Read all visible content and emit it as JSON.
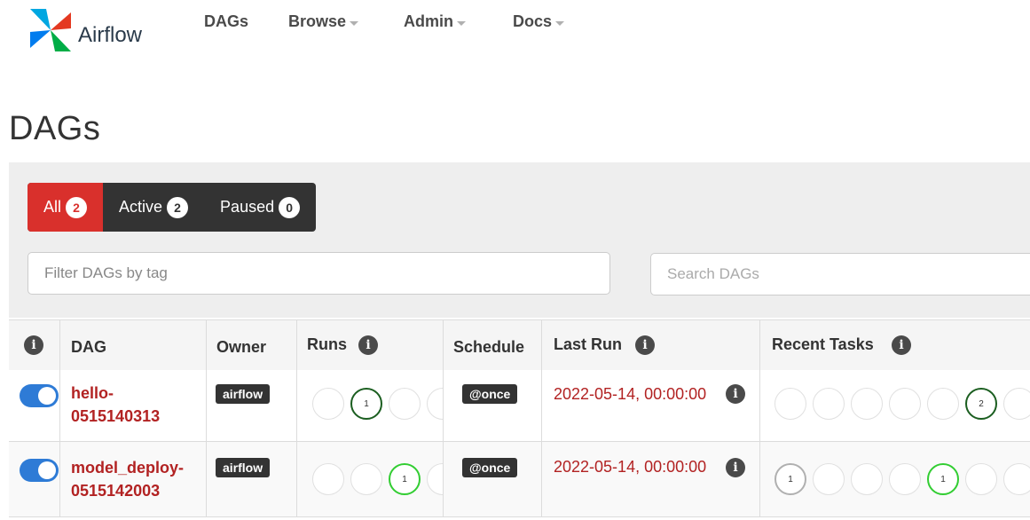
{
  "app": {
    "brand": "Airflow",
    "nav": {
      "dags": "DAGs",
      "browse": "Browse",
      "admin": "Admin",
      "docs": "Docs"
    }
  },
  "page": {
    "title": "DAGs"
  },
  "filters": {
    "all": {
      "label": "All",
      "count": "2"
    },
    "active": {
      "label": "Active",
      "count": "2"
    },
    "paused": {
      "label": "Paused",
      "count": "0"
    }
  },
  "tag_filter": {
    "placeholder": "Filter DAGs by tag"
  },
  "search": {
    "placeholder": "Search DAGs"
  },
  "table": {
    "headers": {
      "info": "i",
      "dag": "DAG",
      "owner": "Owner",
      "runs": "Runs",
      "schedule": "Schedule",
      "last_run": "Last Run",
      "recent_tasks": "Recent Tasks"
    },
    "rows": [
      {
        "dag_line1": "hello-",
        "dag_line2": "0515140313",
        "owner": "airflow",
        "runs": [
          "",
          "1",
          "",
          ""
        ],
        "schedule": "@once",
        "last_run": "2022-05-14, 00:00:00",
        "recent_tasks": [
          "",
          "",
          "",
          "",
          "",
          "2",
          ""
        ]
      },
      {
        "dag_line1": "model_deploy-",
        "dag_line2": "0515142003",
        "owner": "airflow",
        "runs": [
          "",
          "",
          "1",
          ""
        ],
        "schedule": "@once",
        "last_run": "2022-05-14, 00:00:00",
        "recent_tasks": [
          "1",
          "",
          "",
          "",
          "1",
          "",
          ""
        ]
      }
    ]
  },
  "colors": {
    "accent_red": "#d9302c",
    "link_red": "#b22222",
    "toggle_blue": "#2e7bd6",
    "success_green": "#1b5e20",
    "running_green": "#32cd32"
  }
}
